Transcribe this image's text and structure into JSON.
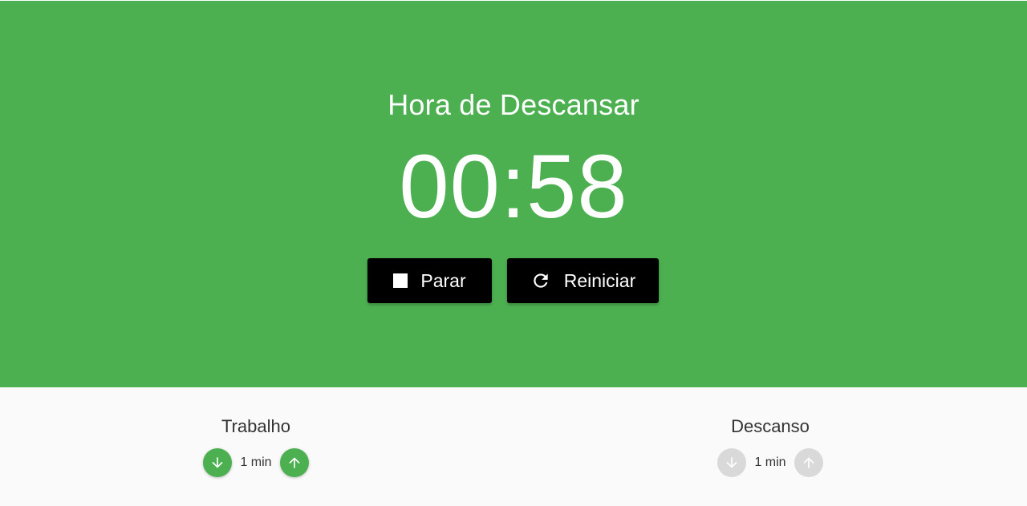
{
  "status_title": "Hora de Descansar",
  "timer": "00:58",
  "colors": {
    "accent": "#4caf50",
    "button_bg": "#000000",
    "disabled": "#d9d9d9"
  },
  "controls": {
    "stop": {
      "label": "Parar",
      "icon": "stop-icon"
    },
    "reset": {
      "label": "Reiniciar",
      "icon": "refresh-icon"
    }
  },
  "settings": {
    "work": {
      "label": "Trabalho",
      "value": "1 min",
      "enabled": true,
      "decrease_icon": "arrow-down-icon",
      "increase_icon": "arrow-up-icon"
    },
    "rest": {
      "label": "Descanso",
      "value": "1 min",
      "enabled": false,
      "decrease_icon": "arrow-down-icon",
      "increase_icon": "arrow-up-icon"
    }
  }
}
